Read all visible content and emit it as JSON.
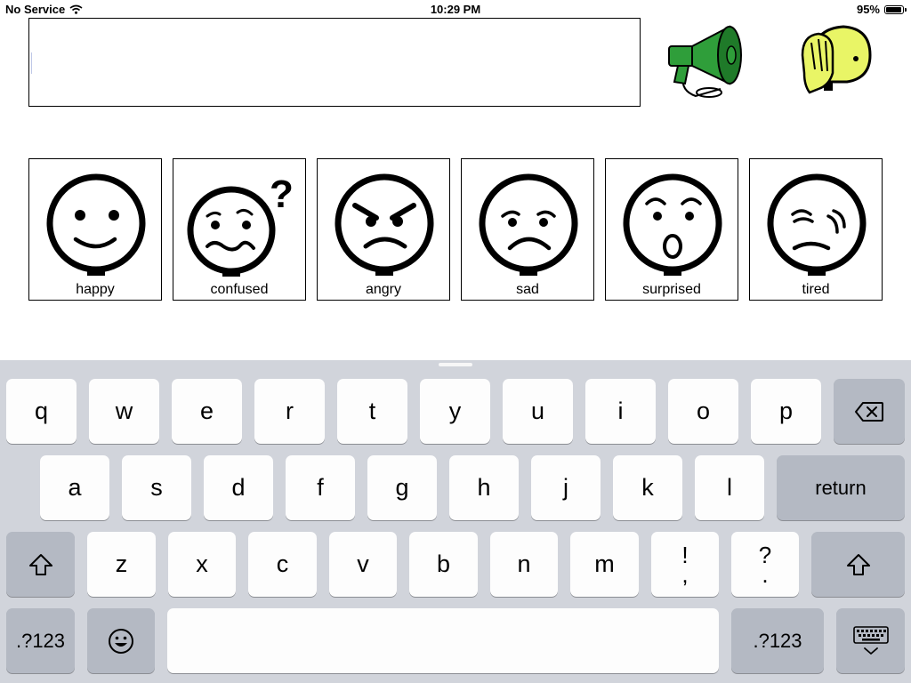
{
  "status_bar": {
    "carrier": "No Service",
    "time": "10:29 PM",
    "battery_percent": "95%",
    "battery_level": 0.95
  },
  "message_box": {
    "value": ""
  },
  "emotions": [
    {
      "label": "happy"
    },
    {
      "label": "confused"
    },
    {
      "label": "angry"
    },
    {
      "label": "sad"
    },
    {
      "label": "surprised"
    },
    {
      "label": "tired"
    }
  ],
  "keyboard": {
    "row1": [
      "q",
      "w",
      "e",
      "r",
      "t",
      "y",
      "u",
      "i",
      "o",
      "p"
    ],
    "row2": [
      "a",
      "s",
      "d",
      "f",
      "g",
      "h",
      "j",
      "k",
      "l"
    ],
    "return_label": "return",
    "row3": [
      "z",
      "x",
      "c",
      "v",
      "b",
      "n",
      "m"
    ],
    "punct1_top": "!",
    "punct1_bottom": ",",
    "punct2_top": "?",
    "punct2_bottom": ".",
    "numbers_label": ".?123"
  },
  "colors": {
    "speak_green": "#2f9e3a",
    "clear_face_yellow": "#e9f566",
    "keyboard_bg": "#d1d4db"
  }
}
